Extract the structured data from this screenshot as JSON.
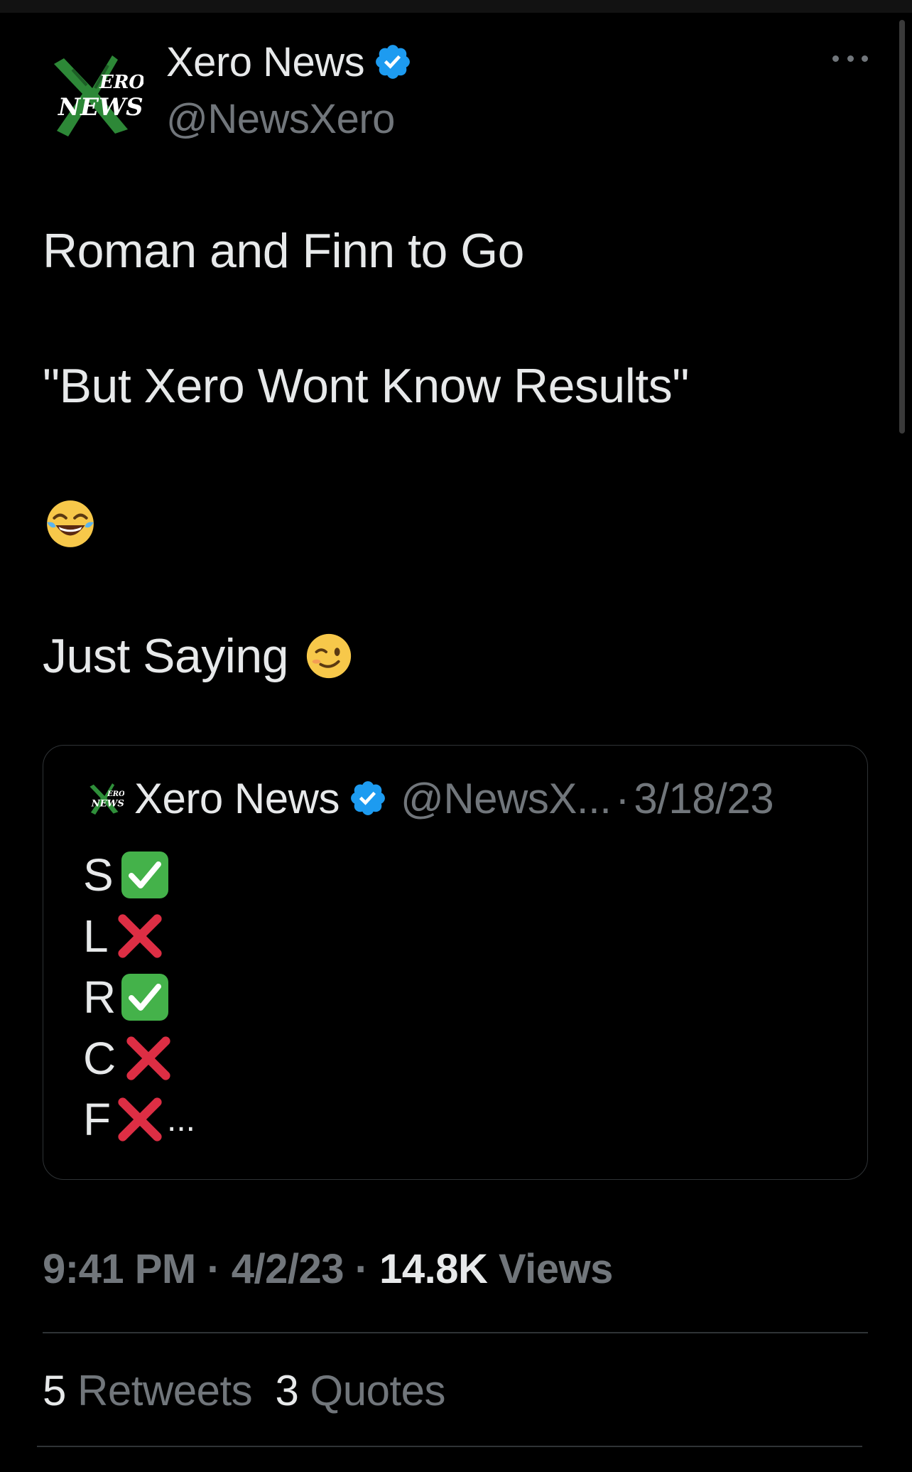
{
  "author": {
    "name": "Xero News",
    "handle": "@NewsXero",
    "avatar_logo_text": "XERO NEWS",
    "verified_color": "#1d9bf0"
  },
  "tweet": {
    "line1": "Roman and Finn to Go",
    "line2": "\"But Xero Wont Know Results\"",
    "line4": "Just Saying",
    "emojis": [
      "face-with-tears-of-joy",
      "winking-face"
    ]
  },
  "quoted": {
    "name": "Xero News",
    "handle": "@NewsX...",
    "separator": "·",
    "date": "3/18/23",
    "rows": [
      {
        "letter": "S",
        "mark": "check"
      },
      {
        "letter": "L",
        "mark": "cross"
      },
      {
        "letter": "R",
        "mark": "check"
      },
      {
        "letter": "C",
        "mark": "cross"
      },
      {
        "letter": "F",
        "mark": "cross"
      }
    ],
    "ellipsis": "..."
  },
  "meta": {
    "time": "9:41 PM",
    "sep1": "·",
    "date": "4/2/23",
    "sep2": "·",
    "views_count": "14.8K",
    "views_label": "Views"
  },
  "stats": {
    "retweets_count": "5",
    "retweets_label": "Retweets",
    "quotes_count": "3",
    "quotes_label": "Quotes"
  }
}
